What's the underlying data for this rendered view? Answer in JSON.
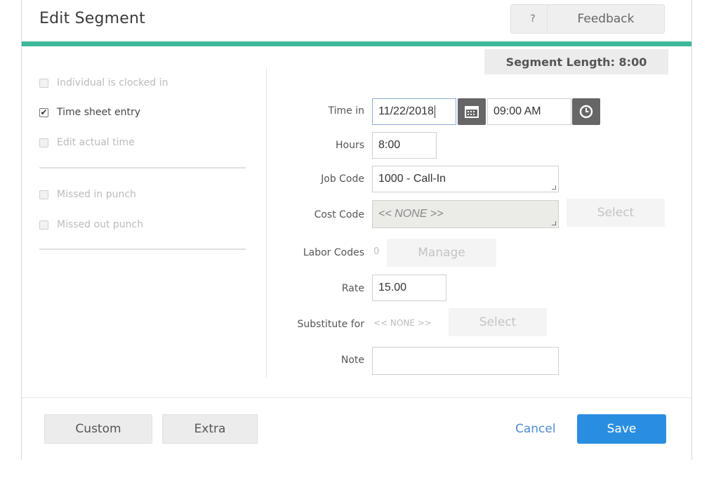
{
  "dialog": {
    "title": "Edit Segment",
    "help_label": "?",
    "feedback_label": "Feedback",
    "accent_color": "#3db89a"
  },
  "segment_length": "Segment Length: 8:00",
  "options": {
    "individual_clocked_in": {
      "label": "Individual is clocked in",
      "checked": false
    },
    "time_sheet_entry": {
      "label": "Time sheet entry",
      "checked": true
    },
    "edit_actual_time": {
      "label": "Edit actual time",
      "checked": false
    },
    "missed_in_punch": {
      "label": "Missed in punch",
      "checked": false
    },
    "missed_out_punch": {
      "label": "Missed out punch",
      "checked": false
    }
  },
  "form": {
    "time_in": {
      "label": "Time in",
      "date": "11/22/2018",
      "time": "09:00 AM"
    },
    "hours": {
      "label": "Hours",
      "value": "8:00"
    },
    "job_code": {
      "label": "Job Code",
      "value": "1000 - Call-In"
    },
    "cost_code": {
      "label": "Cost Code",
      "value": "<< NONE >>",
      "select_label": "Select"
    },
    "labor_codes": {
      "label": "Labor Codes",
      "count": "0",
      "manage_label": "Manage"
    },
    "rate": {
      "label": "Rate",
      "value": "15.00"
    },
    "substitute_for": {
      "label": "Substitute for",
      "value": "<< NONE >>",
      "select_label": "Select"
    },
    "note": {
      "label": "Note",
      "value": ""
    }
  },
  "footer": {
    "custom_label": "Custom",
    "extra_label": "Extra",
    "cancel_label": "Cancel",
    "save_label": "Save",
    "save_color": "#2a8ee0"
  }
}
